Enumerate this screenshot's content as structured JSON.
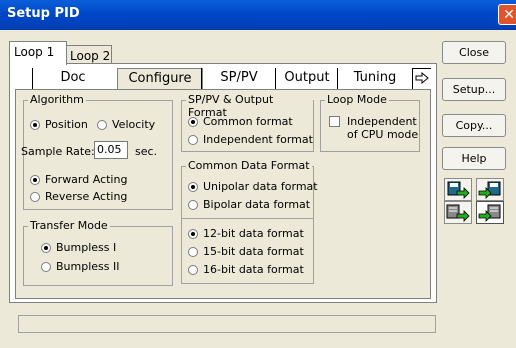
{
  "window": {
    "title": "Setup PID",
    "close_glyph": "✕"
  },
  "loop_tabs": [
    "Loop 1",
    "Loop 2"
  ],
  "tabs": [
    "Doc",
    "Configure",
    "SP/PV",
    "Output",
    "Tuning"
  ],
  "tab_scroll_icon": "right-arrow-icon",
  "algorithm": {
    "title": "Algorithm",
    "position": "Position",
    "velocity": "Velocity",
    "sample_rate_label": "Sample Rate:",
    "sample_rate_value": "0.05",
    "sample_rate_unit": "sec.",
    "forward": "Forward Acting",
    "reverse": "Reverse Acting"
  },
  "transfer_mode": {
    "title": "Transfer Mode",
    "bumpless1": "Bumpless I",
    "bumpless2": "Bumpless II"
  },
  "sppv_output_format": {
    "title": "SP/PV & Output Format",
    "common": "Common format",
    "independent": "Independent format"
  },
  "loop_mode": {
    "title": "Loop Mode",
    "independent_line1": "Independent",
    "independent_line2": "of CPU mode"
  },
  "common_data_format": {
    "title": "Common Data Format",
    "unipolar": "Unipolar data format",
    "bipolar": "Bipolar data format",
    "bit12": "12-bit data format",
    "bit15": "15-bit data format",
    "bit16": "16-bit data format"
  },
  "buttons": {
    "close": "Close",
    "setup": "Setup...",
    "copy": "Copy...",
    "help": "Help"
  },
  "icon_buttons": [
    "save-to-disk-icon",
    "load-from-disk-icon",
    "save-to-plc-icon",
    "load-from-plc-icon"
  ],
  "status_text": ""
}
